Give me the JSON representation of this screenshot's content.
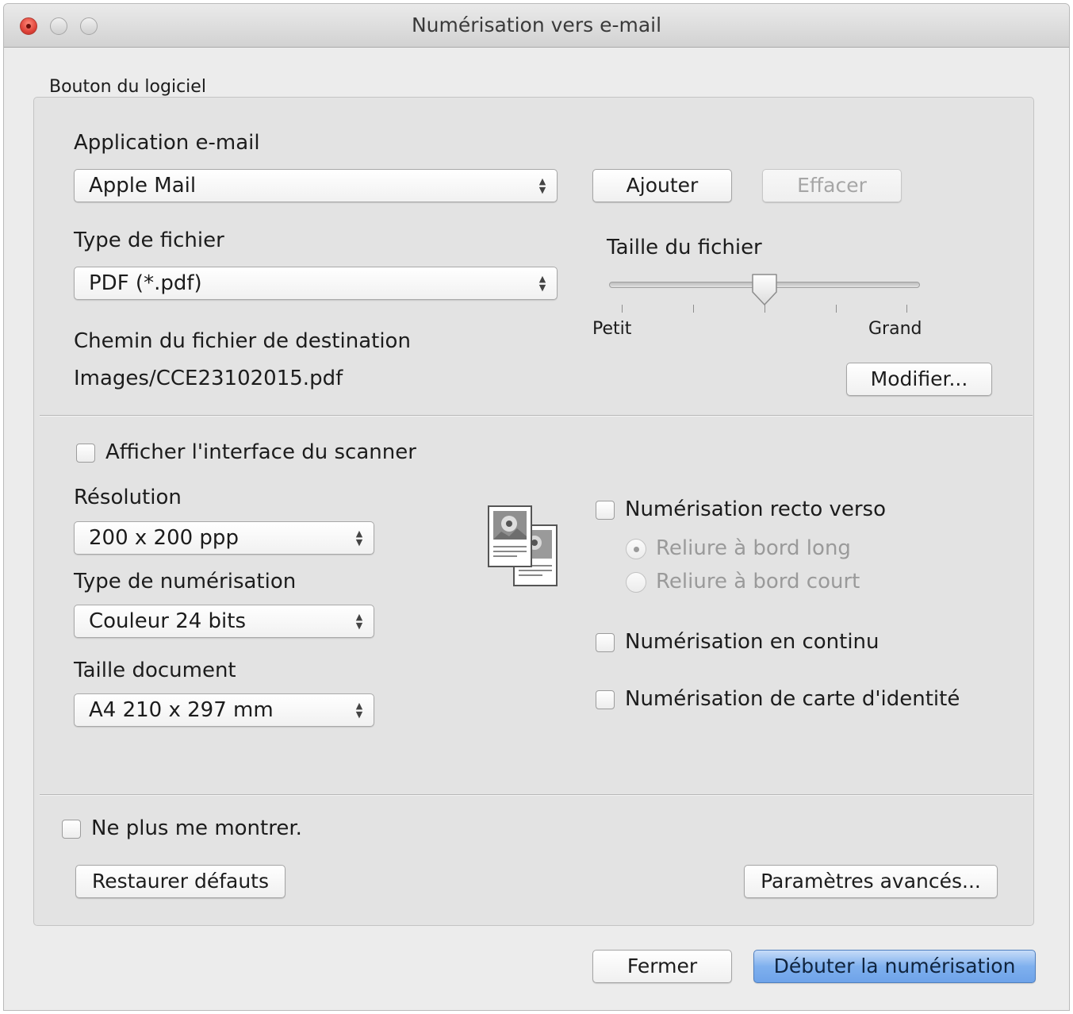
{
  "window": {
    "title": "Numérisation vers e-mail"
  },
  "section": {
    "title": "Bouton du logiciel"
  },
  "email_app": {
    "label": "Application e-mail",
    "value": "Apple Mail",
    "add_label": "Ajouter",
    "delete_label": "Effacer"
  },
  "file_type": {
    "label": "Type de fichier",
    "value": "PDF (*.pdf)"
  },
  "file_size": {
    "label": "Taille du fichier",
    "min_label": "Petit",
    "max_label": "Grand",
    "level": 0.5
  },
  "destination": {
    "label": "Chemin du fichier de destination",
    "value": "Images/CCE23102015.pdf",
    "modify_label": "Modifier..."
  },
  "scanner_interface": {
    "label": "Afficher l'interface du scanner",
    "checked": false
  },
  "resolution": {
    "label": "Résolution",
    "value": "200 x 200 ppp"
  },
  "scan_type": {
    "label": "Type de numérisation",
    "value": "Couleur 24 bits"
  },
  "doc_size": {
    "label": "Taille document",
    "value": "A4 210 x 297 mm"
  },
  "duplex": {
    "label": "Numérisation recto verso",
    "checked": false,
    "options": [
      {
        "label": "Reliure à bord long",
        "selected": true
      },
      {
        "label": "Reliure à bord court",
        "selected": false
      }
    ]
  },
  "continuous": {
    "label": "Numérisation en continu",
    "checked": false
  },
  "id_card": {
    "label": "Numérisation de carte d'identité",
    "checked": false
  },
  "dont_show": {
    "label": "Ne plus me montrer.",
    "checked": false
  },
  "buttons": {
    "restore": "Restaurer défauts",
    "advanced": "Paramètres avancés...",
    "close": "Fermer",
    "start": "Débuter la numérisation"
  },
  "icons": {
    "duplex_preview": "duplex-pages-icon",
    "popup_arrows": "updown-arrows-icon"
  },
  "colors": {
    "primary_button": "#7fb0ee",
    "window_bg": "#ececec",
    "close_button": "#e0443a"
  }
}
